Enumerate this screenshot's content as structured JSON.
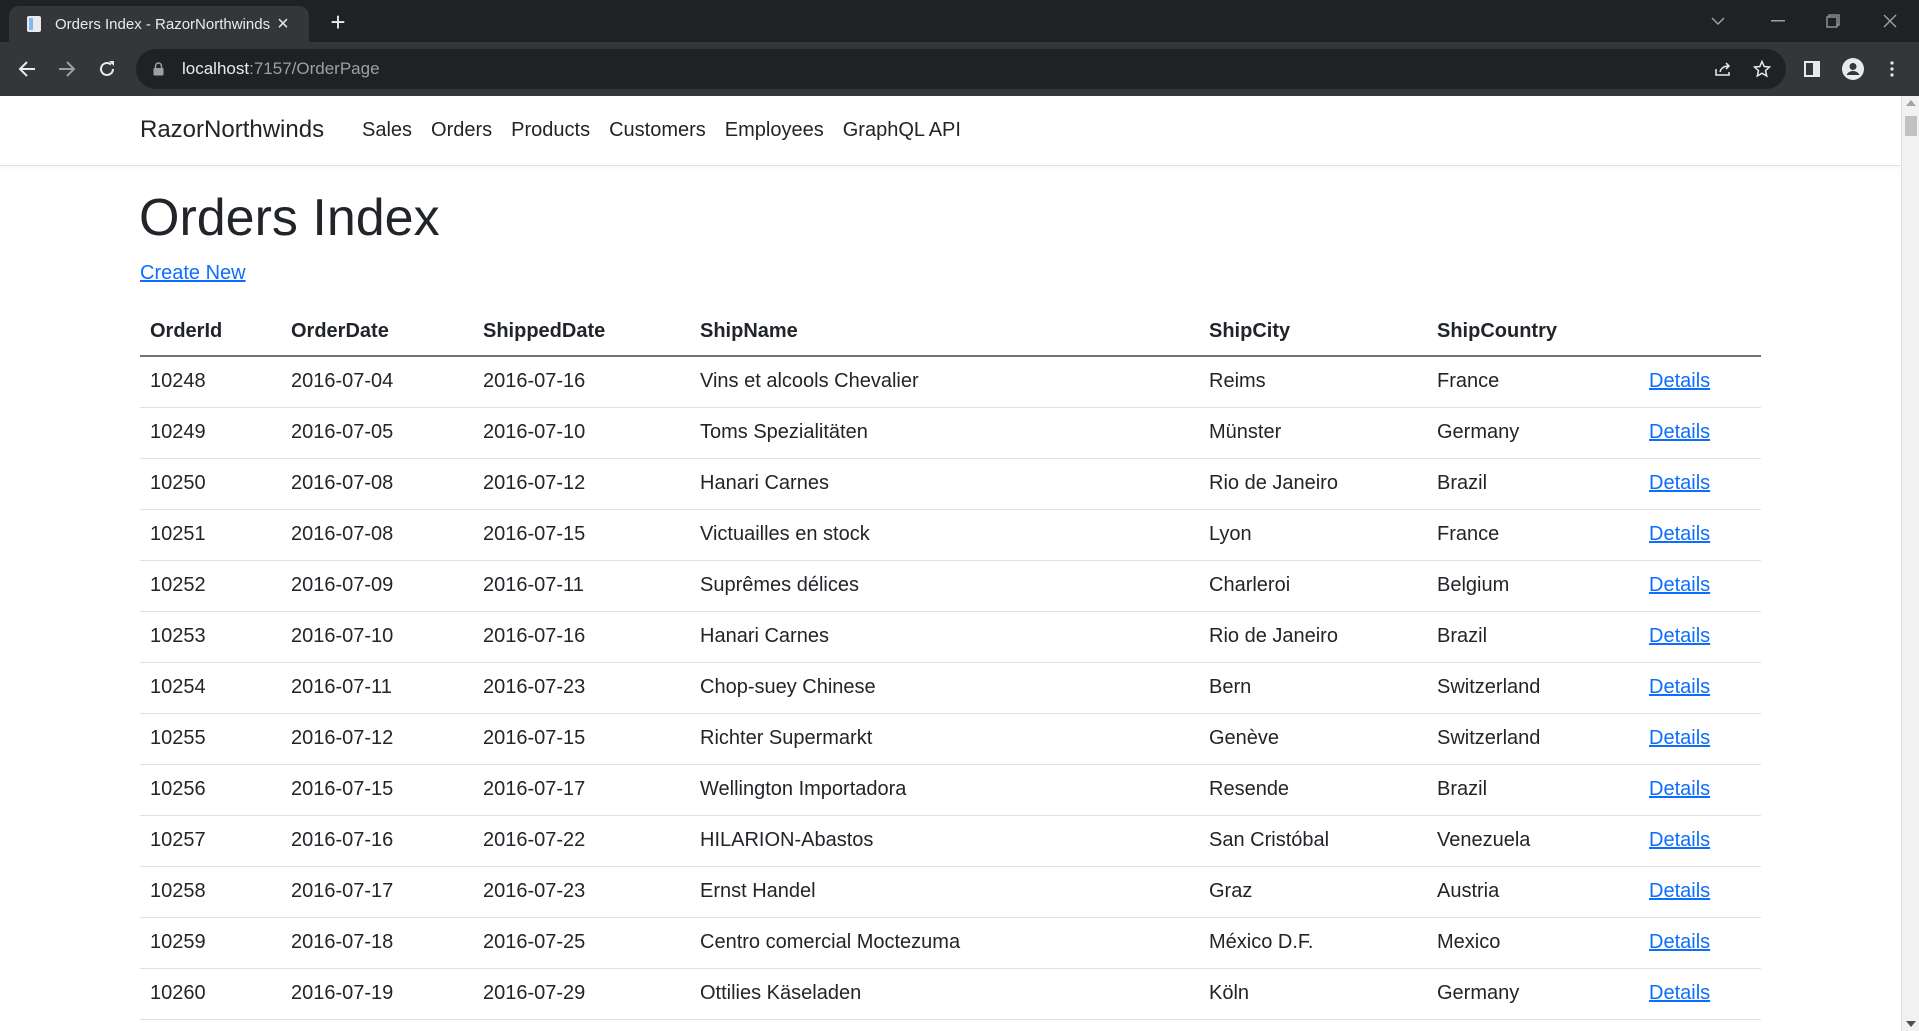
{
  "browser": {
    "tab_title": "Orders Index - RazorNorthwinds",
    "url_host": "localhost",
    "url_path": ":7157/OrderPage"
  },
  "site": {
    "brand": "RazorNorthwinds",
    "nav": [
      "Sales",
      "Orders",
      "Products",
      "Customers",
      "Employees",
      "GraphQL API"
    ]
  },
  "page": {
    "heading": "Orders Index",
    "create_new": "Create New"
  },
  "table": {
    "columns": [
      "OrderId",
      "OrderDate",
      "ShippedDate",
      "ShipName",
      "ShipCity",
      "ShipCountry",
      ""
    ],
    "details_label": "Details",
    "rows": [
      [
        "10248",
        "2016-07-04",
        "2016-07-16",
        "Vins et alcools Chevalier",
        "Reims",
        "France"
      ],
      [
        "10249",
        "2016-07-05",
        "2016-07-10",
        "Toms Spezialitäten",
        "Münster",
        "Germany"
      ],
      [
        "10250",
        "2016-07-08",
        "2016-07-12",
        "Hanari Carnes",
        "Rio de Janeiro",
        "Brazil"
      ],
      [
        "10251",
        "2016-07-08",
        "2016-07-15",
        "Victuailles en stock",
        "Lyon",
        "France"
      ],
      [
        "10252",
        "2016-07-09",
        "2016-07-11",
        "Suprêmes délices",
        "Charleroi",
        "Belgium"
      ],
      [
        "10253",
        "2016-07-10",
        "2016-07-16",
        "Hanari Carnes",
        "Rio de Janeiro",
        "Brazil"
      ],
      [
        "10254",
        "2016-07-11",
        "2016-07-23",
        "Chop-suey Chinese",
        "Bern",
        "Switzerland"
      ],
      [
        "10255",
        "2016-07-12",
        "2016-07-15",
        "Richter Supermarkt",
        "Genève",
        "Switzerland"
      ],
      [
        "10256",
        "2016-07-15",
        "2016-07-17",
        "Wellington Importadora",
        "Resende",
        "Brazil"
      ],
      [
        "10257",
        "2016-07-16",
        "2016-07-22",
        "HILARION-Abastos",
        "San Cristóbal",
        "Venezuela"
      ],
      [
        "10258",
        "2016-07-17",
        "2016-07-23",
        "Ernst Handel",
        "Graz",
        "Austria"
      ],
      [
        "10259",
        "2016-07-18",
        "2016-07-25",
        "Centro comercial Moctezuma",
        "México D.F.",
        "Mexico"
      ],
      [
        "10260",
        "2016-07-19",
        "2016-07-29",
        "Ottilies Käseladen",
        "Köln",
        "Germany"
      ]
    ]
  },
  "colors": {
    "chrome_dark": "#202124",
    "chrome_toolbar": "#35363a",
    "link": "#0d6efd",
    "text": "#212529"
  }
}
